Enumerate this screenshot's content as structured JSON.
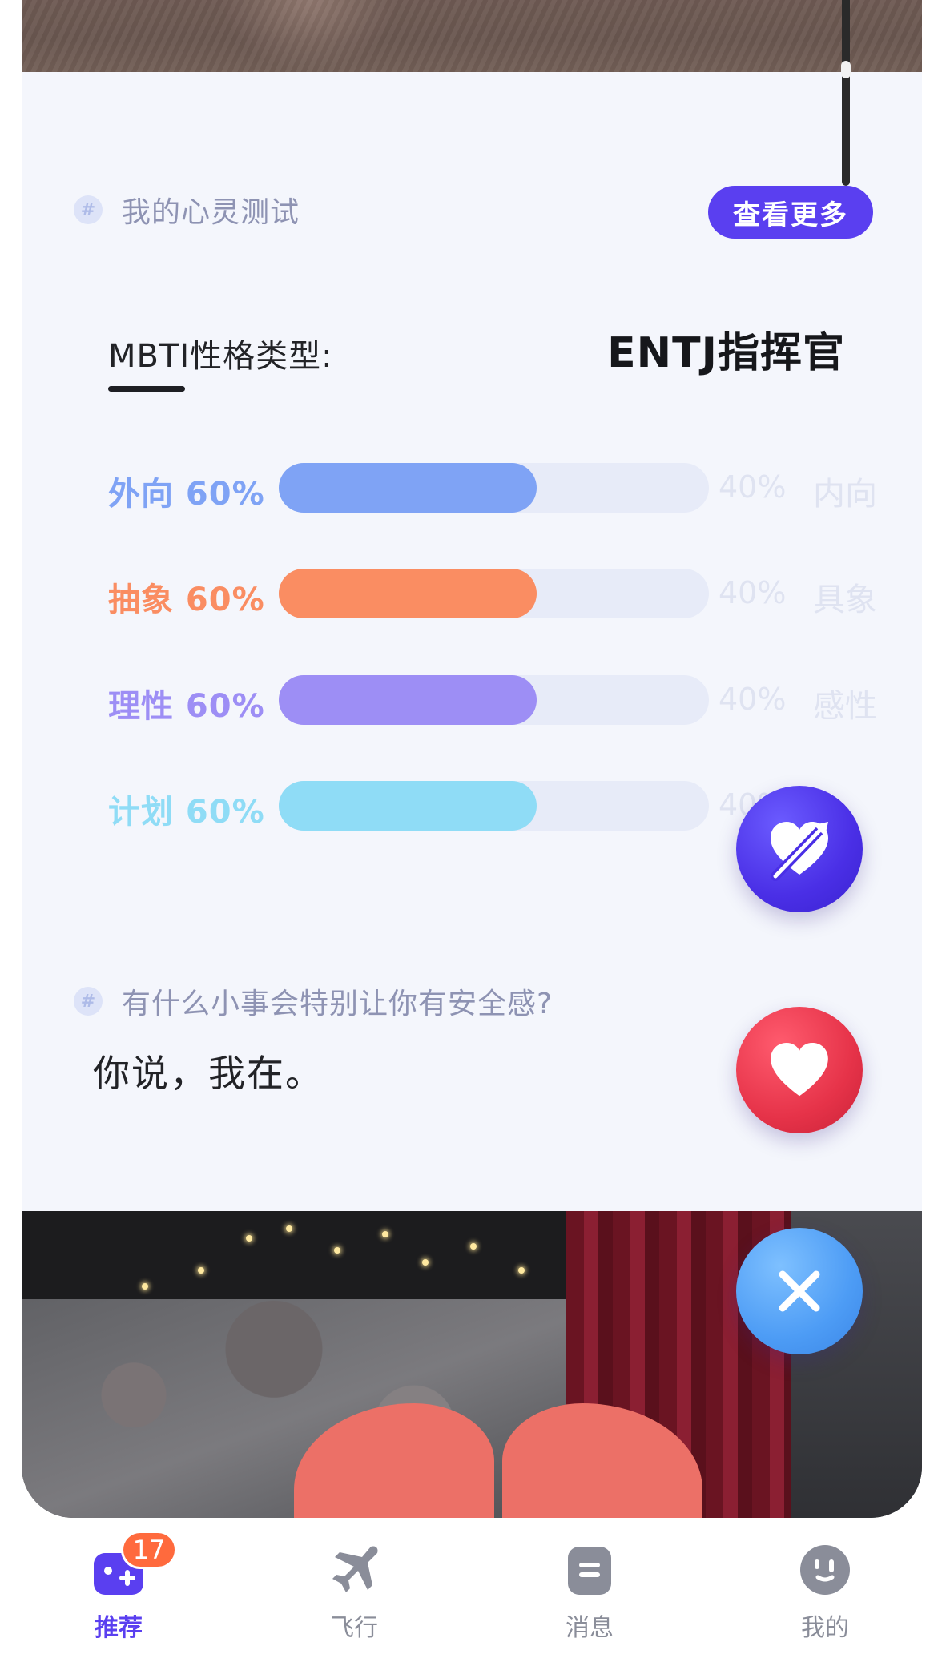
{
  "mind_test": {
    "section_title": "我的心灵测试",
    "more_button": "查看更多",
    "mbti_label": "MBTI性格类型:",
    "mbti_type": "ENTJ指挥官",
    "traits": [
      {
        "left_label": "外向 60%",
        "right_pct": "40%",
        "right_label": "内向",
        "fill_percent": 60,
        "color": "#7fa3f5"
      },
      {
        "left_label": "抽象 60%",
        "right_pct": "40%",
        "right_label": "具象",
        "fill_percent": 60,
        "color": "#fa8d62"
      },
      {
        "left_label": "理性 60%",
        "right_pct": "40%",
        "right_label": "感性",
        "fill_percent": 60,
        "color": "#9d8ef5"
      },
      {
        "left_label": "计划 60%",
        "right_pct": "40%",
        "right_label": "",
        "fill_percent": 60,
        "color": "#8fdcf6"
      }
    ]
  },
  "qa": {
    "question": "有什么小事会特别让你有安全感?",
    "answer": "你说，我在。"
  },
  "actions": {
    "cupid_icon": "heart-arrow-icon",
    "like_icon": "heart-icon",
    "dislike_icon": "close-icon"
  },
  "tabbar": {
    "tabs": [
      {
        "label": "推荐",
        "icon": "recommend-icon",
        "badge": "17",
        "active": true
      },
      {
        "label": "飞行",
        "icon": "airplane-icon",
        "active": false
      },
      {
        "label": "消息",
        "icon": "message-icon",
        "active": false
      },
      {
        "label": "我的",
        "icon": "profile-face-icon",
        "active": false
      }
    ]
  },
  "colors": {
    "accent": "#5a3ff0",
    "badge": "#ff6a3d"
  }
}
